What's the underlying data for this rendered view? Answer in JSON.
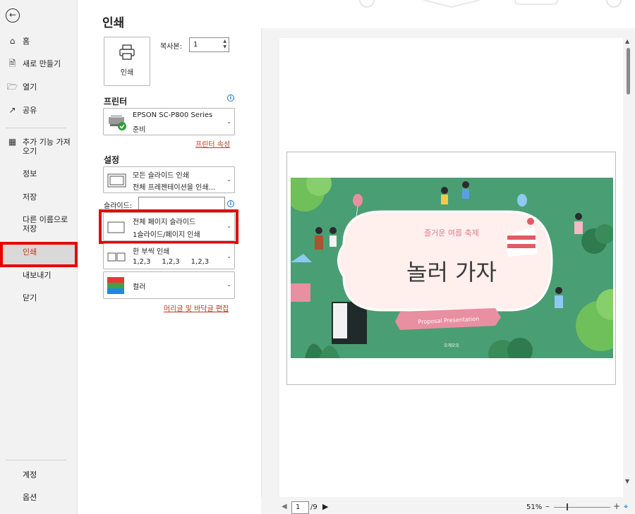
{
  "nav": {
    "back_icon": "back-arrow-icon",
    "items": [
      {
        "label": "홈",
        "icon": "home-icon"
      },
      {
        "label": "새로 만들기",
        "icon": "new-file-icon"
      },
      {
        "label": "열기",
        "icon": "folder-open-icon"
      },
      {
        "label": "공유",
        "icon": "share-icon"
      },
      {
        "label": "추가 기능 가져오기",
        "icon": "addins-icon"
      },
      {
        "label": "정보"
      },
      {
        "label": "저장"
      },
      {
        "label": "다른 이름으로 저장"
      },
      {
        "label": "인쇄"
      },
      {
        "label": "내보내기"
      },
      {
        "label": "닫기"
      },
      {
        "label": "계정"
      },
      {
        "label": "옵션"
      }
    ],
    "active": "인쇄",
    "highlight_color": "#e60000"
  },
  "main": {
    "title": "인쇄",
    "print_button": "인쇄",
    "copies_label": "복사본:",
    "copies_value": "1",
    "printer_label": "프린터",
    "printer_name": "EPSON SC-P800 Series",
    "printer_status": "준비",
    "printer_props_link": "프린터 속성",
    "settings_label": "설정",
    "scope_line1": "모든 슬라이드 인쇄",
    "scope_line2": "전체 프레젠테이션을 인쇄...",
    "slides_label": "슬라이드:",
    "slides_value": "",
    "layout_line1": "전체 페이지 슬라이드",
    "layout_line2": "1슬라이드/페이지 인쇄",
    "collate_line1": "한 부씩 인쇄",
    "collate_line2": "1,2,3     1,2,3     1,2,3",
    "color_label": "컬러",
    "header_footer_link": "머리글 및 바닥글 편집"
  },
  "slide": {
    "banner": "즐거운 여름 축제",
    "title": "놀러 가자",
    "ribbon": "Proposal Presentation",
    "footer": "오게오오",
    "bg_color": "#4a9e74",
    "cloud_color": "#fff0ee",
    "pink": "#e88fa2"
  },
  "footer": {
    "page_current": "1",
    "page_total": "/9",
    "zoom": "51%"
  }
}
